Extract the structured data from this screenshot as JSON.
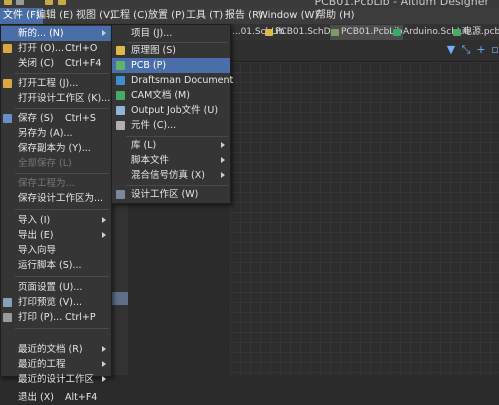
{
  "window": {
    "title": "PCB01.PcbLib - Altium Designer"
  },
  "menubar": {
    "file": "文件 (F)",
    "edit": "编辑 (E)",
    "view": "视图 (V)",
    "project": "工程 (C)",
    "place": "放置 (P)",
    "tools": "工具 (T)",
    "reports": "报告 (R)",
    "window": "Window (W)",
    "help": "帮助 (H)"
  },
  "tabs": [
    {
      "label": "...01.SchLib"
    },
    {
      "label": "PCB01.SchDoc"
    },
    {
      "label": "PCB01.PcbLib"
    },
    {
      "label": "Arduino.SchLib"
    },
    {
      "label": "电源.pcbd"
    }
  ],
  "file_menu": {
    "new": "新的... (N)",
    "open": "打开 (O)...",
    "open_shortcut": "Ctrl+O",
    "close": "关闭 (C)",
    "close_shortcut": "Ctrl+F4",
    "open_project": "打开工程 (J)...",
    "open_workspace": "打开设计工作区 (K)...",
    "save": "保存 (S)",
    "save_shortcut": "Ctrl+S",
    "save_as": "另存为 (A)...",
    "save_copy_as": "保存副本为 (Y)...",
    "save_all": "全部保存 (L)",
    "save_project_as": "保存工程为...",
    "save_workspace_as": "保存设计工作区为...",
    "import": "导入 (I)",
    "export": "导出 (E)",
    "import_wizard": "导入向导",
    "run_script": "运行脚本 (S)...",
    "page_setup": "页面设置 (U)...",
    "print_preview": "打印预览 (V)...",
    "print": "打印 (P)...",
    "print_shortcut": "Ctrl+P",
    "recent_docs": "最近的文档 (R)",
    "recent_projects": "最近的工程",
    "recent_workspaces": "最近的设计工作区",
    "exit": "退出 (X)",
    "exit_shortcut": "Alt+F4"
  },
  "new_submenu": {
    "project": "项目 (J)...",
    "schematic": "原理图 (S)",
    "pcb": "PCB (P)",
    "draftsman": "Draftsman Document",
    "cam": "CAM文档 (M)",
    "output_job": "Output Job文件 (U)",
    "component": "元件 (C)...",
    "library": "库 (L)",
    "script_files": "脚本文件",
    "mixed_signal": "混合信号仿真 (X)",
    "design_workspace": "设计工作区 (W)"
  }
}
